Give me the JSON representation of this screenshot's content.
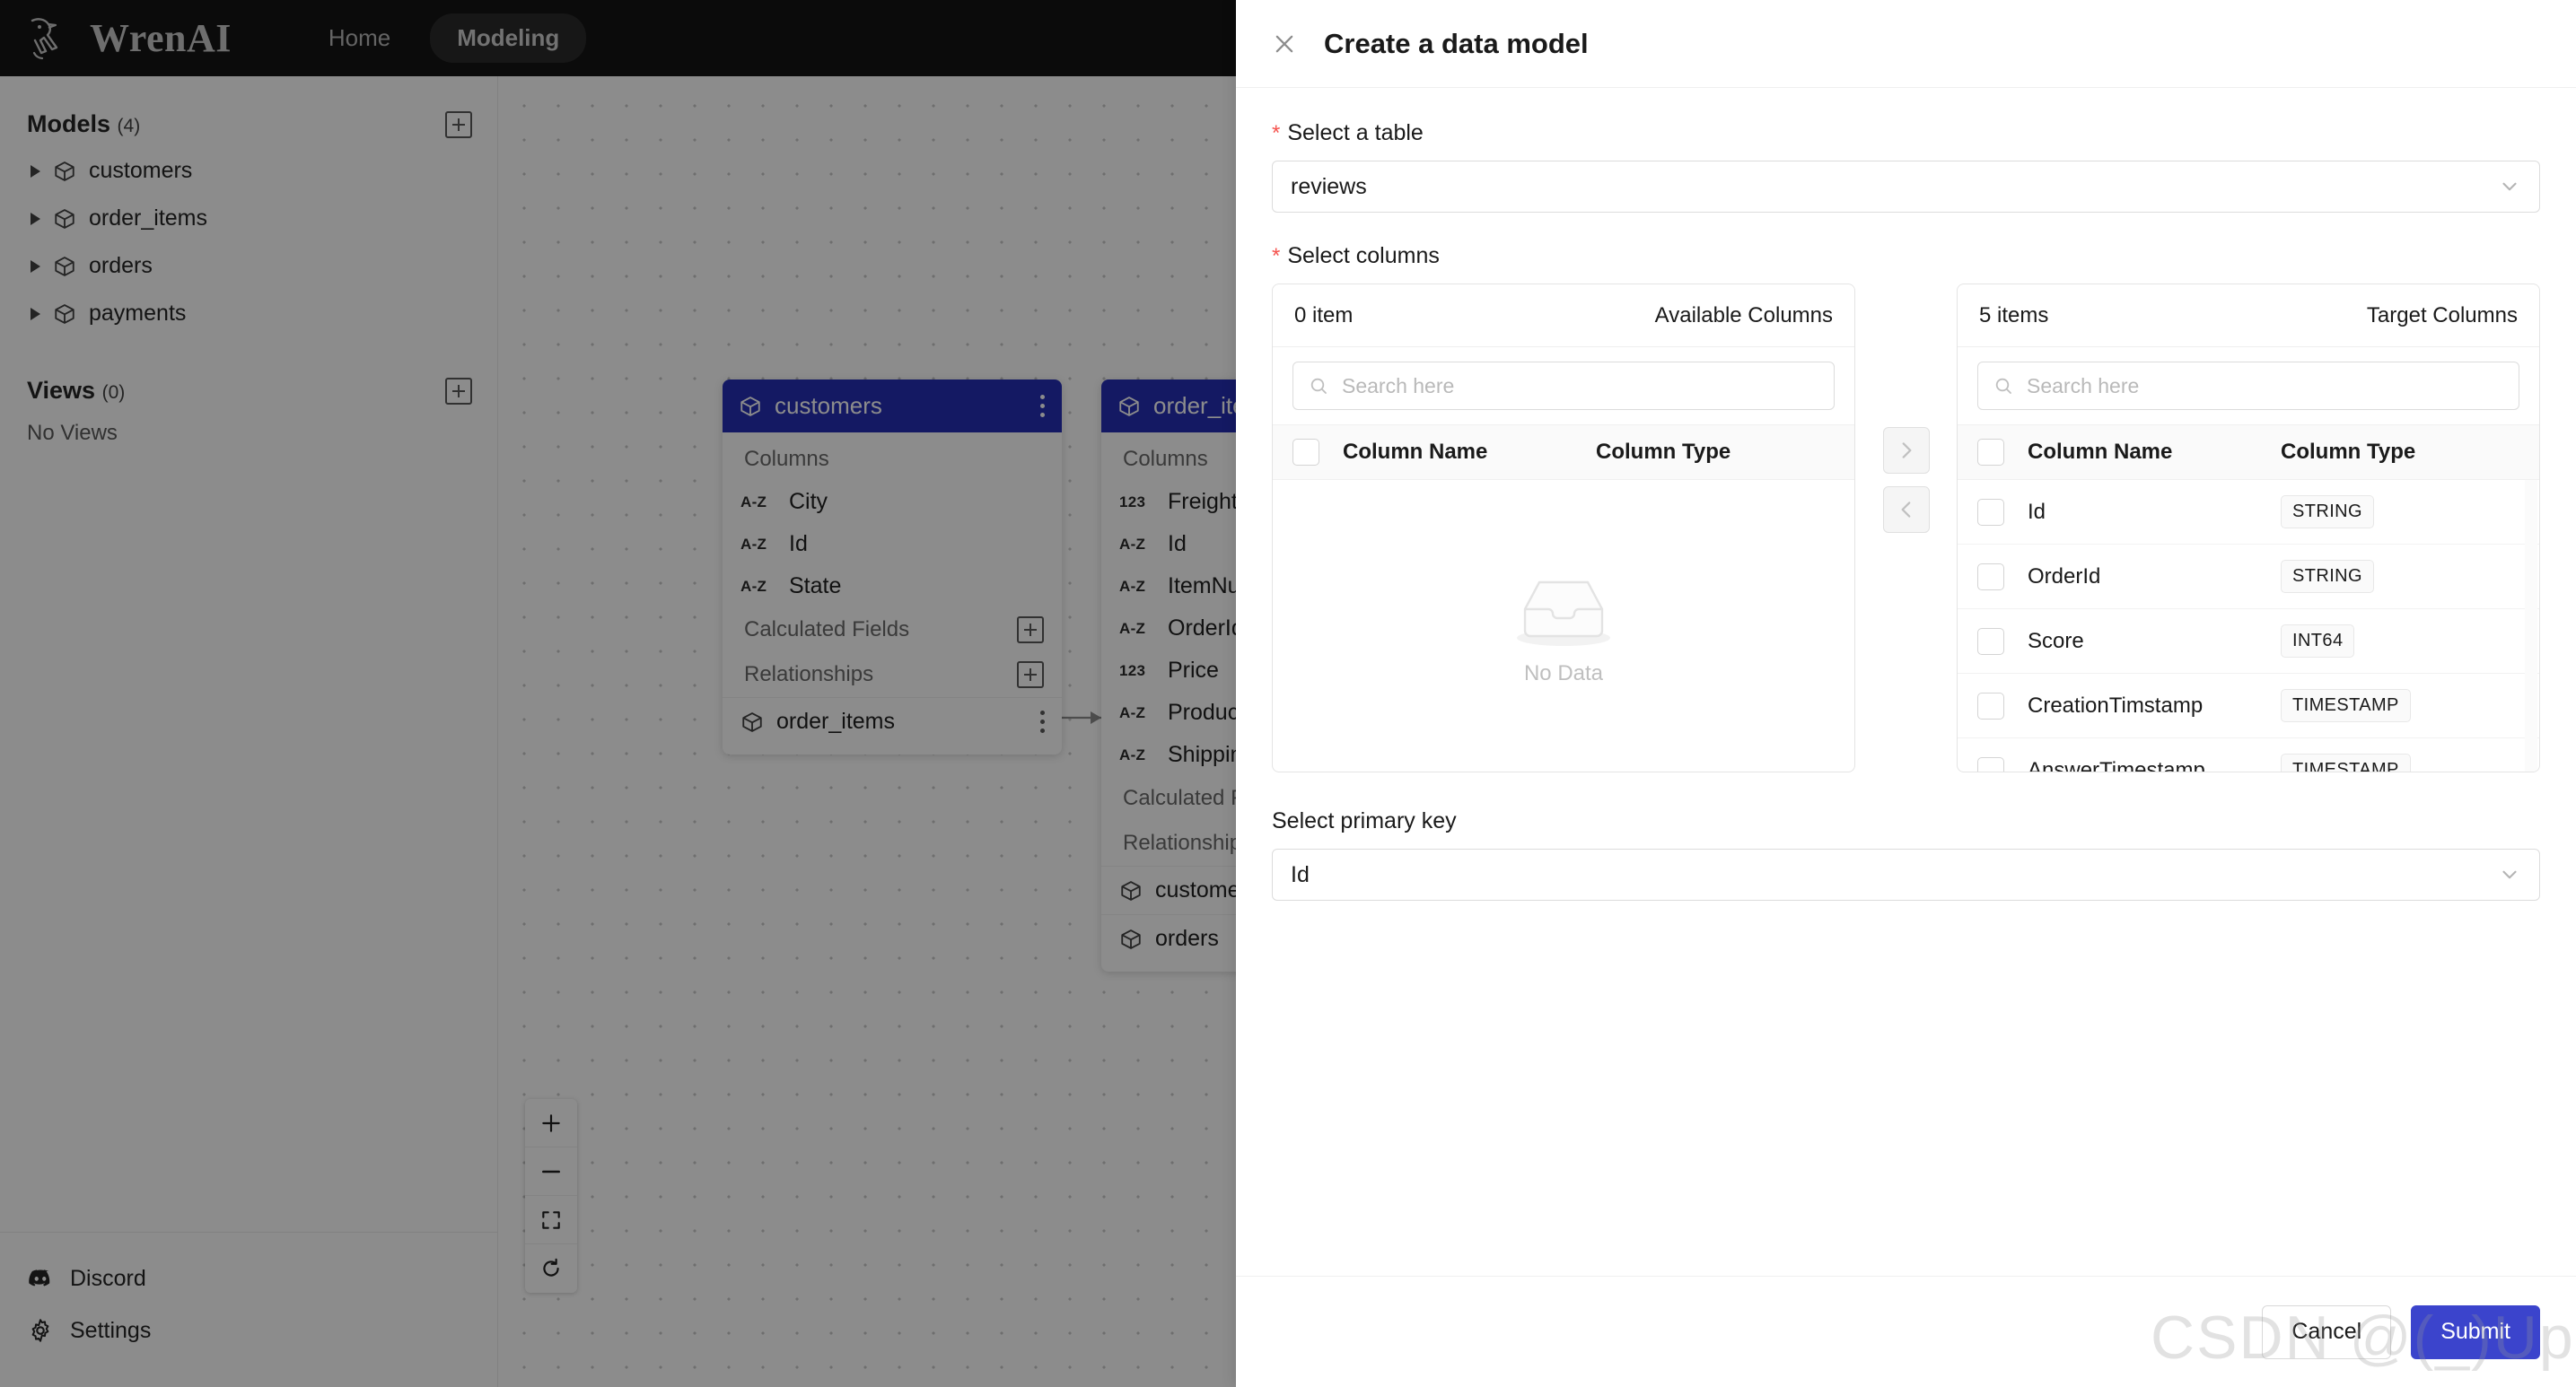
{
  "topnav": {
    "brand": "WrenAI",
    "logo_icon": "wren-bird-logo",
    "items": [
      {
        "label": "Home",
        "active": false
      },
      {
        "label": "Modeling",
        "active": true
      }
    ]
  },
  "sidebar": {
    "models_section": {
      "title": "Models",
      "count": "(4)",
      "add_icon": "plus-box-icon",
      "items": [
        {
          "label": "customers",
          "icon": "model-cube-icon",
          "caret": "caret-right-icon"
        },
        {
          "label": "order_items",
          "icon": "model-cube-icon",
          "caret": "caret-right-icon"
        },
        {
          "label": "orders",
          "icon": "model-cube-icon",
          "caret": "caret-right-icon"
        },
        {
          "label": "payments",
          "icon": "model-cube-icon",
          "caret": "caret-right-icon"
        }
      ]
    },
    "views_section": {
      "title": "Views",
      "count": "(0)",
      "add_icon": "plus-box-icon",
      "empty_text": "No Views"
    },
    "footer": [
      {
        "label": "Discord",
        "icon": "discord-icon"
      },
      {
        "label": "Settings",
        "icon": "gear-icon"
      }
    ]
  },
  "canvas": {
    "zoom_controls": [
      {
        "name": "zoom-in",
        "glyph": "+"
      },
      {
        "name": "zoom-out",
        "glyph": "−"
      },
      {
        "name": "fit-view",
        "glyph": "fit-icon"
      },
      {
        "name": "reset-view",
        "glyph": "reset-icon"
      }
    ],
    "nodes": [
      {
        "title": "customers",
        "columns_label": "Columns",
        "columns": [
          {
            "name": "City",
            "type_badge": "A-Z"
          },
          {
            "name": "Id",
            "type_badge": "A-Z"
          },
          {
            "name": "State",
            "type_badge": "A-Z"
          }
        ],
        "calculated_fields_label": "Calculated Fields",
        "relationships_label": "Relationships",
        "relationships": [
          {
            "name": "order_items"
          }
        ]
      },
      {
        "title": "order_items",
        "columns_label": "Columns",
        "columns": [
          {
            "name": "Freight",
            "type_badge": "123"
          },
          {
            "name": "Id",
            "type_badge": "A-Z"
          },
          {
            "name": "ItemNumber",
            "type_badge": "A-Z"
          },
          {
            "name": "OrderId",
            "type_badge": "A-Z"
          },
          {
            "name": "Price",
            "type_badge": "123"
          },
          {
            "name": "ProductId",
            "type_badge": "A-Z"
          },
          {
            "name": "ShippingLimitDate",
            "type_badge": "A-Z"
          }
        ],
        "calculated_fields_label": "Calculated Fields",
        "relationships_label": "Relationships",
        "relationships": [
          {
            "name": "customers"
          },
          {
            "name": "orders"
          }
        ]
      }
    ]
  },
  "drawer": {
    "title": "Create a data model",
    "close_icon": "close-icon",
    "select_table": {
      "label": "Select a table",
      "required_mark": "*",
      "value": "reviews",
      "chevron_icon": "chevron-down-icon"
    },
    "select_columns": {
      "label": "Select columns",
      "required_mark": "*",
      "available": {
        "count_text": "0 item",
        "title": "Available Columns",
        "search_placeholder": "Search here",
        "search_icon": "search-icon",
        "headers": {
          "name": "Column Name",
          "type": "Column Type"
        },
        "rows": [],
        "empty_text": "No Data",
        "empty_icon": "empty-inbox-icon"
      },
      "transfer_buttons": [
        {
          "name": "move-right",
          "glyph": "›",
          "disabled": true
        },
        {
          "name": "move-left",
          "glyph": "‹",
          "disabled": true
        }
      ],
      "target": {
        "count_text": "5 items",
        "title": "Target Columns",
        "search_placeholder": "Search here",
        "search_icon": "search-icon",
        "headers": {
          "name": "Column Name",
          "type": "Column Type"
        },
        "rows": [
          {
            "name": "Id",
            "type": "STRING"
          },
          {
            "name": "OrderId",
            "type": "STRING"
          },
          {
            "name": "Score",
            "type": "INT64"
          },
          {
            "name": "CreationTimstamp",
            "type": "TIMESTAMP"
          },
          {
            "name": "AnswerTimestamp",
            "type": "TIMESTAMP"
          }
        ]
      }
    },
    "primary_key": {
      "label": "Select primary key",
      "value": "Id",
      "chevron_icon": "chevron-down-icon"
    },
    "footer": {
      "cancel_label": "Cancel",
      "submit_label": "Submit"
    }
  },
  "watermark": {
    "text": "CSDN @(_)Up"
  },
  "colors": {
    "topnav_bg": "#141414",
    "node_header": "#262fb5",
    "primary_button": "#3b44cc",
    "required_red": "#f5534e",
    "overlay": "rgba(0,0,0,0.45)"
  }
}
